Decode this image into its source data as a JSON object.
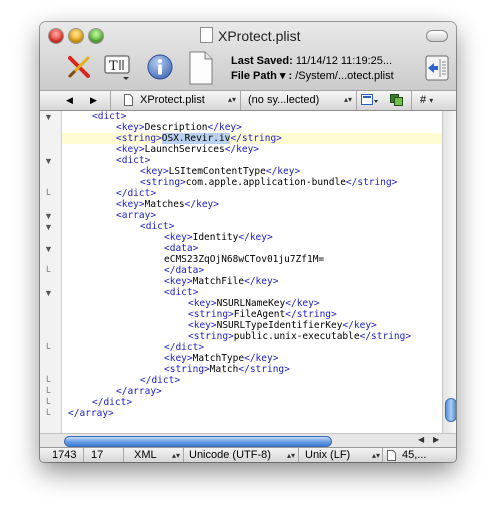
{
  "window": {
    "title": "XProtect.plist"
  },
  "toolbar": {
    "last_saved_label": "Last Saved:",
    "last_saved_value": "11/14/12 11:19:25...",
    "file_path_label": "File Path ▾ :",
    "file_path_value": "/System/...otect.plist",
    "icons": [
      "magic-wand-icon",
      "text-format-icon",
      "info-icon",
      "document-icon",
      "sidebar-toggle-icon"
    ]
  },
  "navbar": {
    "back": "◀",
    "forward": "▶",
    "file_name": "XProtect.plist",
    "symbol": "(no sy...lected)",
    "hash": "#"
  },
  "code": {
    "lines": [
      {
        "text": "<dict>",
        "indent": 1
      },
      {
        "text": "<key>Description</key>",
        "indent": 2
      },
      {
        "text": "<string>OSX.Revir.iv</string>",
        "indent": 2
      },
      {
        "text": "<key>LaunchServices</key>",
        "indent": 2
      },
      {
        "text": "<dict>",
        "indent": 2
      },
      {
        "text": "<key>LSItemContentType</key>",
        "indent": 3
      },
      {
        "text": "<string>com.apple.application-bundle</string>",
        "indent": 3
      },
      {
        "text": "</dict>",
        "indent": 2
      },
      {
        "text": "<key>Matches</key>",
        "indent": 2
      },
      {
        "text": "<array>",
        "indent": 2
      },
      {
        "text": "<dict>",
        "indent": 3
      },
      {
        "text": "<key>Identity</key>",
        "indent": 4
      },
      {
        "text": "<data>",
        "indent": 4
      },
      {
        "text": "eCMS23ZqOjN68wCTov01ju7Zf1M=",
        "indent": 4
      },
      {
        "text": "</data>",
        "indent": 4
      },
      {
        "text": "<key>MatchFile</key>",
        "indent": 4
      },
      {
        "text": "<dict>",
        "indent": 4
      },
      {
        "text": "<key>NSURLNameKey</key>",
        "indent": 5
      },
      {
        "text": "<string>FileAgent</string>",
        "indent": 5
      },
      {
        "text": "<key>NSURLTypeIdentifierKey</key>",
        "indent": 5
      },
      {
        "text": "<string>public.unix-executable</string>",
        "indent": 5
      },
      {
        "text": "</dict>",
        "indent": 4
      },
      {
        "text": "<key>MatchType</key>",
        "indent": 4
      },
      {
        "text": "<string>Match</string>",
        "indent": 4
      },
      {
        "text": "</dict>",
        "indent": 3
      },
      {
        "text": "</array>",
        "indent": 2
      },
      {
        "text": "</dict>",
        "indent": 1
      },
      {
        "text": "</array>",
        "indent": 0
      }
    ],
    "selected_text": "OSX.Revir.iv"
  },
  "status": {
    "line": "1743",
    "column": "17",
    "syntax": "XML",
    "encoding": "Unicode (UTF-8)",
    "line_endings": "Unix (LF)",
    "size": "45,..."
  },
  "colors": {
    "tag": "#2020c8",
    "highlight": "#fffcd4",
    "selection": "#b9d0ee",
    "scroll_accent": "#4f83cf"
  }
}
